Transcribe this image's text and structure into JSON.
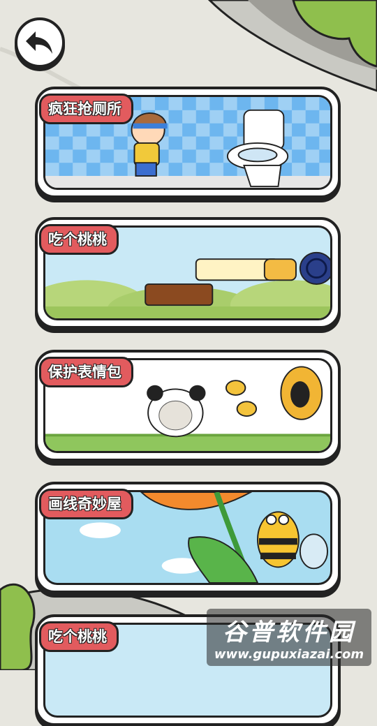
{
  "header": {
    "back_icon": "back-arrow-icon"
  },
  "levels": [
    {
      "title": "疯狂抢厕所",
      "scene": "boy-needs-toilet"
    },
    {
      "title": "吃个桃桃",
      "scene": "stretchy-cat-platform"
    },
    {
      "title": "保护表情包",
      "scene": "panda-meme-bees"
    },
    {
      "title": "画线奇妙屋",
      "scene": "bee-on-flower"
    },
    {
      "title": "吃个桃桃",
      "scene": "partial-card"
    }
  ],
  "watermark": {
    "title": "谷普软件园",
    "url": "www.gupuxiazai.com"
  },
  "colors": {
    "tag_red": "#e25b5e",
    "outline": "#222222",
    "background": "#e7e6df"
  }
}
